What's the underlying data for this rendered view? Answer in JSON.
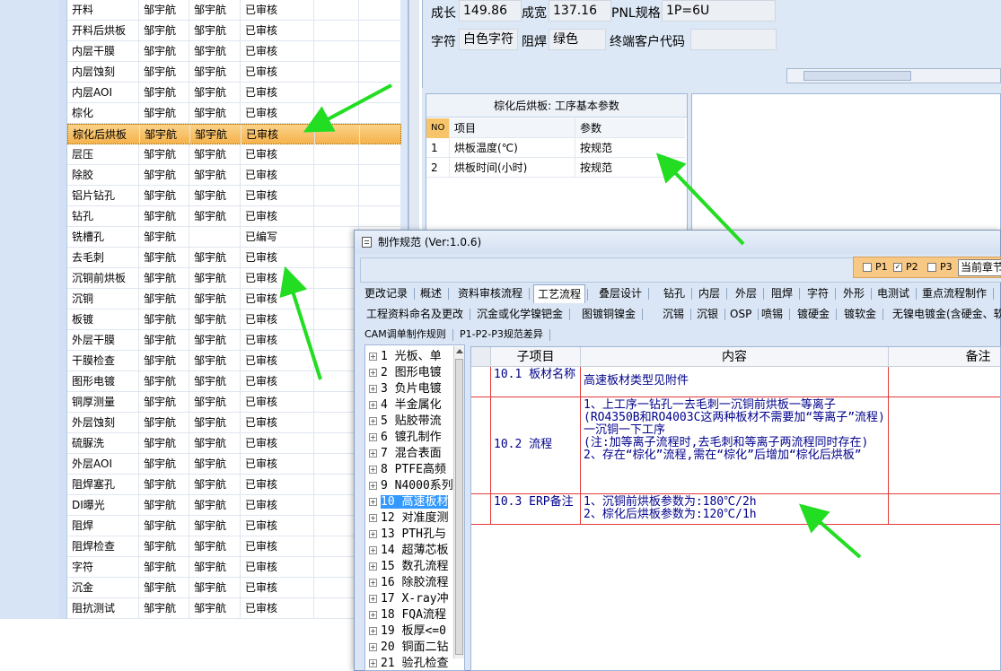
{
  "left_list": {
    "rows": [
      {
        "step": "开料",
        "c2": "邹宇航",
        "c3": "邹宇航",
        "status": "已审核"
      },
      {
        "step": "开料后烘板",
        "c2": "邹宇航",
        "c3": "邹宇航",
        "status": "已审核"
      },
      {
        "step": "内层干膜",
        "c2": "邹宇航",
        "c3": "邹宇航",
        "status": "已审核"
      },
      {
        "step": "内层蚀刻",
        "c2": "邹宇航",
        "c3": "邹宇航",
        "status": "已审核"
      },
      {
        "step": "内层AOI",
        "c2": "邹宇航",
        "c3": "邹宇航",
        "status": "已审核"
      },
      {
        "step": "棕化",
        "c2": "邹宇航",
        "c3": "邹宇航",
        "status": "已审核"
      },
      {
        "step": "棕化后烘板",
        "c2": "邹宇航",
        "c3": "邹宇航",
        "status": "已审核"
      },
      {
        "step": "层压",
        "c2": "邹宇航",
        "c3": "邹宇航",
        "status": "已审核"
      },
      {
        "step": "除胶",
        "c2": "邹宇航",
        "c3": "邹宇航",
        "status": "已审核"
      },
      {
        "step": "铝片钻孔",
        "c2": "邹宇航",
        "c3": "邹宇航",
        "status": "已审核"
      },
      {
        "step": "钻孔",
        "c2": "邹宇航",
        "c3": "邹宇航",
        "status": "已审核"
      },
      {
        "step": "铣槽孔",
        "c2": "邹宇航",
        "c3": "",
        "status": "已编写"
      },
      {
        "step": "去毛刺",
        "c2": "邹宇航",
        "c3": "邹宇航",
        "status": "已审核"
      },
      {
        "step": "沉铜前烘板",
        "c2": "邹宇航",
        "c3": "邹宇航",
        "status": "已审核"
      },
      {
        "step": "沉铜",
        "c2": "邹宇航",
        "c3": "邹宇航",
        "status": "已审核"
      },
      {
        "step": "板镀",
        "c2": "邹宇航",
        "c3": "邹宇航",
        "status": "已审核"
      },
      {
        "step": "外层干膜",
        "c2": "邹宇航",
        "c3": "邹宇航",
        "status": "已审核"
      },
      {
        "step": "干膜检查",
        "c2": "邹宇航",
        "c3": "邹宇航",
        "status": "已审核"
      },
      {
        "step": "图形电镀",
        "c2": "邹宇航",
        "c3": "邹宇航",
        "status": "已审核"
      },
      {
        "step": "铜厚测量",
        "c2": "邹宇航",
        "c3": "邹宇航",
        "status": "已审核"
      },
      {
        "step": "外层蚀刻",
        "c2": "邹宇航",
        "c3": "邹宇航",
        "status": "已审核"
      },
      {
        "step": "硫脲洗",
        "c2": "邹宇航",
        "c3": "邹宇航",
        "status": "已审核"
      },
      {
        "step": "外层AOI",
        "c2": "邹宇航",
        "c3": "邹宇航",
        "status": "已审核"
      },
      {
        "step": "阻焊塞孔",
        "c2": "邹宇航",
        "c3": "邹宇航",
        "status": "已审核"
      },
      {
        "step": "DI曝光",
        "c2": "邹宇航",
        "c3": "邹宇航",
        "status": "已审核"
      },
      {
        "step": "阻焊",
        "c2": "邹宇航",
        "c3": "邹宇航",
        "status": "已审核"
      },
      {
        "step": "阻焊检查",
        "c2": "邹宇航",
        "c3": "邹宇航",
        "status": "已审核"
      },
      {
        "step": "字符",
        "c2": "邹宇航",
        "c3": "邹宇航",
        "status": "已审核"
      },
      {
        "step": "沉金",
        "c2": "邹宇航",
        "c3": "邹宇航",
        "status": "已审核"
      },
      {
        "step": "阻抗测试",
        "c2": "邹宇航",
        "c3": "邹宇航",
        "status": "已审核"
      }
    ],
    "selected_index": 6
  },
  "info": {
    "len_label": "成长",
    "len_value": "149.86",
    "wid_label": "成宽",
    "wid_value": "137.16",
    "pnl_label": "PNL规格",
    "pnl_value": "1P=6U",
    "char_label": "字符",
    "char_value": "白色字符",
    "mask_label": "阻焊",
    "mask_value": "绿色",
    "cust_label": "终端客户代码",
    "cust_value": ""
  },
  "params": {
    "title": "棕化后烘板: 工序基本参数",
    "col_no": "NO",
    "col_item": "项目",
    "col_param": "参数",
    "rows": [
      {
        "no": "1",
        "item": "烘板温度(℃)",
        "param": "按规范"
      },
      {
        "no": "2",
        "item": "烘板时间(小时)",
        "param": "按规范"
      }
    ]
  },
  "dialog": {
    "title": "制作规范 (Ver:1.0.6)",
    "p1": "P1",
    "p2": "P2",
    "p3": "P3",
    "current_chapter": "当前章节",
    "tabs_row1": [
      "更改记录",
      "概述",
      "资料审核流程",
      "工艺流程",
      "叠层设计",
      "钻孔",
      "内层",
      "外层",
      "阻焊",
      "字符",
      "外形",
      "电测试",
      "重点流程制作"
    ],
    "active_tab": "工艺流程",
    "tabs_row2": [
      "工程资料命名及更改",
      "沉金或化学镍钯金",
      "图镀铜镍金",
      "沉锡",
      "沉银",
      "OSP",
      "喷锡",
      "镀硬金",
      "镀软金",
      "无镍电镀金(含硬金、软金"
    ],
    "tabs_row3": [
      "CAM调单制作规则",
      "P1-P2-P3规范差异"
    ],
    "tree": [
      {
        "label": "1 光板、单"
      },
      {
        "label": "2 图形电镀"
      },
      {
        "label": "3 负片电镀"
      },
      {
        "label": "4 半金属化"
      },
      {
        "label": "5 贴胶带流"
      },
      {
        "label": "6 镀孔制作"
      },
      {
        "label": "7 混合表面"
      },
      {
        "label": "8 PTFE高频"
      },
      {
        "label": "9 N4000系列"
      },
      {
        "label": "10 高速板材"
      },
      {
        "label": "12 对准度测"
      },
      {
        "label": "13 PTH孔与"
      },
      {
        "label": "14 超薄芯板"
      },
      {
        "label": "15 数孔流程"
      },
      {
        "label": "16 除胶流程"
      },
      {
        "label": "17 X-ray冲"
      },
      {
        "label": "18 FQA流程"
      },
      {
        "label": "19 板厚<=0"
      },
      {
        "label": "20 铜面二钻"
      },
      {
        "label": "21 验孔检查"
      }
    ],
    "tree_selected_index": 9,
    "grid": {
      "col_sub": "子项目",
      "col_content": "内容",
      "col_note": "备注",
      "rows": [
        {
          "sub": "10.1 板材名称",
          "content": "高速板材类型见附件"
        },
        {
          "sub": "10.2 流程",
          "content": "1、上工序一钻孔一去毛刺一沉铜前烘板一等离子(RO4350B和RO4003C这两种板材不需要加“等离子”流程)一沉铜一下工序\n(注:加等离子流程时,去毛刺和等离子两流程同时存在)\n2、存在“棕化”流程,需在“棕化”后增加“棕化后烘板”"
        },
        {
          "sub": "10.3 ERP备注",
          "content": "1、沉铜前烘板参数为:180℃/2h\n2、棕化后烘板参数为:120℃/1h"
        }
      ]
    }
  },
  "colors": {
    "arrow": "#22dd22",
    "grid_red": "#e23a3a",
    "content_text": "#00008b",
    "selection": "#f5b24c"
  }
}
